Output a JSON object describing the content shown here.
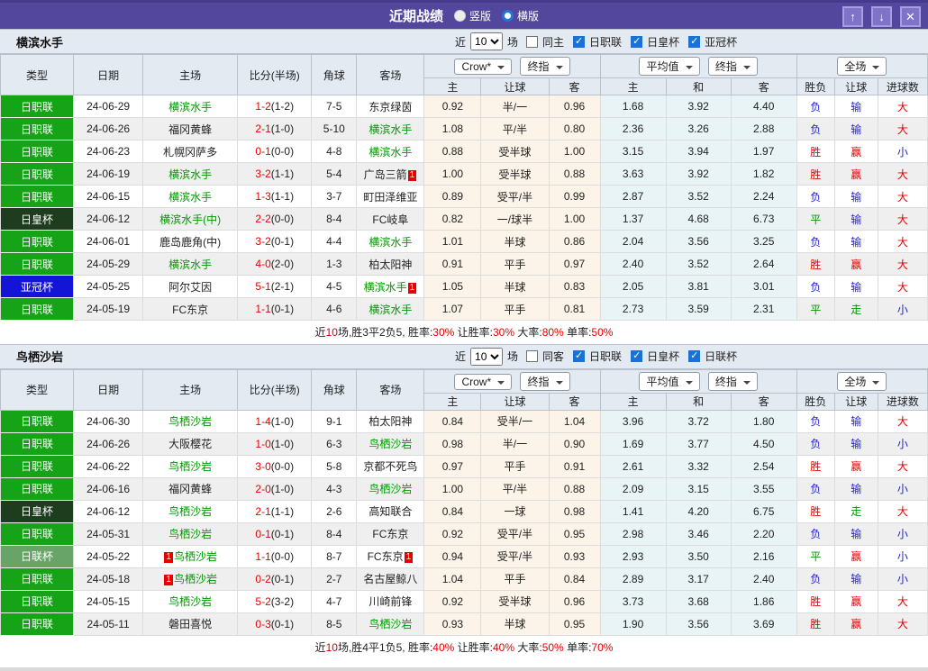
{
  "title_bar": {
    "title": "近期战绩",
    "radio_vertical_label": "竖版",
    "radio_horizontal_label": "横版",
    "up_icon": "↑",
    "down_icon": "↓",
    "close_icon": "✕"
  },
  "columns": {
    "type": "类型",
    "date": "日期",
    "home": "主场",
    "score": "比分(半场)",
    "corner": "角球",
    "away": "客场",
    "odds_source_dd": "Crow*",
    "odds_final_dd": "终指",
    "avg_dd": "平均值",
    "avg_final_dd": "终指",
    "fulltime_dd": "全场",
    "odds_home": "主",
    "odds_handicap": "让球",
    "odds_away": "客",
    "avg_home": "主",
    "avg_draw": "和",
    "avg_away": "客",
    "result_wdl": "胜负",
    "result_handicap": "让球",
    "result_goals": "进球数"
  },
  "league_colors": {
    "日职联": "#17a317",
    "日皇杯": "#1e3c1e",
    "亚冠杯": "#1414d6",
    "日联杯": "#68a468"
  },
  "result_colors": {
    "r": "#e60000",
    "b": "#2323cc",
    "g": "#009900"
  },
  "sections": [
    {
      "team": "横滨水手",
      "filters": {
        "near": "近",
        "count": "10",
        "games": "场",
        "same": "同主",
        "leagues": [
          "日职联",
          "日皇杯",
          "亚冠杯"
        ]
      },
      "rows": [
        {
          "league": "日职联",
          "date": "24-06-29",
          "home": "横滨水手",
          "home_self": true,
          "away": "东京绿茵",
          "away_self": false,
          "score": "1-2",
          "half": "(1-2)",
          "corner": "7-5",
          "odds": [
            "0.92",
            "半/一",
            "0.96"
          ],
          "avg": [
            "1.68",
            "3.92",
            "4.40"
          ],
          "res": [
            [
              "负",
              "b"
            ],
            [
              "输",
              "b"
            ],
            [
              "大",
              "r"
            ]
          ]
        },
        {
          "league": "日职联",
          "date": "24-06-26",
          "home": "福冈黄蜂",
          "home_self": false,
          "away": "横滨水手",
          "away_self": true,
          "score": "2-1",
          "half": "(1-0)",
          "corner": "5-10",
          "odds": [
            "1.08",
            "平/半",
            "0.80"
          ],
          "avg": [
            "2.36",
            "3.26",
            "2.88"
          ],
          "res": [
            [
              "负",
              "b"
            ],
            [
              "输",
              "b"
            ],
            [
              "大",
              "r"
            ]
          ]
        },
        {
          "league": "日职联",
          "date": "24-06-23",
          "home": "札幌冈萨多",
          "home_self": false,
          "away": "横滨水手",
          "away_self": true,
          "score": "0-1",
          "half": "(0-0)",
          "corner": "4-8",
          "odds": [
            "0.88",
            "受半球",
            "1.00"
          ],
          "avg": [
            "3.15",
            "3.94",
            "1.97"
          ],
          "res": [
            [
              "胜",
              "r"
            ],
            [
              "赢",
              "r"
            ],
            [
              "小",
              "b"
            ]
          ]
        },
        {
          "league": "日职联",
          "date": "24-06-19",
          "home": "横滨水手",
          "home_self": true,
          "away": "广岛三箭",
          "away_self": false,
          "away_card_after": "1",
          "score": "3-2",
          "half": "(1-1)",
          "corner": "5-4",
          "odds": [
            "1.00",
            "受半球",
            "0.88"
          ],
          "avg": [
            "3.63",
            "3.92",
            "1.82"
          ],
          "res": [
            [
              "胜",
              "r"
            ],
            [
              "赢",
              "r"
            ],
            [
              "大",
              "r"
            ]
          ]
        },
        {
          "league": "日职联",
          "date": "24-06-15",
          "home": "横滨水手",
          "home_self": true,
          "away": "町田泽维亚",
          "away_self": false,
          "score": "1-3",
          "half": "(1-1)",
          "corner": "3-7",
          "odds": [
            "0.89",
            "受平/半",
            "0.99"
          ],
          "avg": [
            "2.87",
            "3.52",
            "2.24"
          ],
          "res": [
            [
              "负",
              "b"
            ],
            [
              "输",
              "b"
            ],
            [
              "大",
              "r"
            ]
          ]
        },
        {
          "league": "日皇杯",
          "date": "24-06-12",
          "home": "横滨水手(中)",
          "home_self": true,
          "away": "FC岐阜",
          "away_self": false,
          "score": "2-2",
          "half": "(0-0)",
          "corner": "8-4",
          "odds": [
            "0.82",
            "一/球半",
            "1.00"
          ],
          "avg": [
            "1.37",
            "4.68",
            "6.73"
          ],
          "res": [
            [
              "平",
              "g"
            ],
            [
              "输",
              "b"
            ],
            [
              "大",
              "r"
            ]
          ]
        },
        {
          "league": "日职联",
          "date": "24-06-01",
          "home": "鹿岛鹿角(中)",
          "home_self": false,
          "away": "横滨水手",
          "away_self": true,
          "score": "3-2",
          "half": "(0-1)",
          "corner": "4-4",
          "odds": [
            "1.01",
            "半球",
            "0.86"
          ],
          "avg": [
            "2.04",
            "3.56",
            "3.25"
          ],
          "res": [
            [
              "负",
              "b"
            ],
            [
              "输",
              "b"
            ],
            [
              "大",
              "r"
            ]
          ]
        },
        {
          "league": "日职联",
          "date": "24-05-29",
          "home": "横滨水手",
          "home_self": true,
          "away": "柏太阳神",
          "away_self": false,
          "score": "4-0",
          "half": "(2-0)",
          "corner": "1-3",
          "odds": [
            "0.91",
            "平手",
            "0.97"
          ],
          "avg": [
            "2.40",
            "3.52",
            "2.64"
          ],
          "res": [
            [
              "胜",
              "r"
            ],
            [
              "赢",
              "r"
            ],
            [
              "大",
              "r"
            ]
          ]
        },
        {
          "league": "亚冠杯",
          "date": "24-05-25",
          "home": "阿尔艾因",
          "home_self": false,
          "away": "横滨水手",
          "away_self": true,
          "away_card_after": "1",
          "score": "5-1",
          "half": "(2-1)",
          "corner": "4-5",
          "odds": [
            "1.05",
            "半球",
            "0.83"
          ],
          "avg": [
            "2.05",
            "3.81",
            "3.01"
          ],
          "res": [
            [
              "负",
              "b"
            ],
            [
              "输",
              "b"
            ],
            [
              "大",
              "r"
            ]
          ]
        },
        {
          "league": "日职联",
          "date": "24-05-19",
          "home": "FC东京",
          "home_self": false,
          "away": "横滨水手",
          "away_self": true,
          "score": "1-1",
          "half": "(0-1)",
          "corner": "4-6",
          "odds": [
            "1.07",
            "平手",
            "0.81"
          ],
          "avg": [
            "2.73",
            "3.59",
            "2.31"
          ],
          "res": [
            [
              "平",
              "g"
            ],
            [
              "走",
              "g"
            ],
            [
              "小",
              "b"
            ]
          ]
        }
      ],
      "summary": [
        {
          "t": "近",
          "c": "k"
        },
        {
          "t": "10",
          "c": "r"
        },
        {
          "t": "场,胜3平2负5, 胜率:",
          "c": "k"
        },
        {
          "t": "30%",
          "c": "r"
        },
        {
          "t": " 让胜率:",
          "c": "k"
        },
        {
          "t": "30%",
          "c": "r"
        },
        {
          "t": " 大率:",
          "c": "k"
        },
        {
          "t": "80%",
          "c": "r"
        },
        {
          "t": " 单率:",
          "c": "k"
        },
        {
          "t": "50%",
          "c": "r"
        }
      ]
    },
    {
      "team": "鸟栖沙岩",
      "filters": {
        "near": "近",
        "count": "10",
        "games": "场",
        "same": "同客",
        "leagues": [
          "日职联",
          "日皇杯",
          "日联杯"
        ]
      },
      "rows": [
        {
          "league": "日职联",
          "date": "24-06-30",
          "home": "鸟栖沙岩",
          "home_self": true,
          "away": "柏太阳神",
          "away_self": false,
          "score": "1-4",
          "half": "(1-0)",
          "corner": "9-1",
          "odds": [
            "0.84",
            "受半/一",
            "1.04"
          ],
          "avg": [
            "3.96",
            "3.72",
            "1.80"
          ],
          "res": [
            [
              "负",
              "b"
            ],
            [
              "输",
              "b"
            ],
            [
              "大",
              "r"
            ]
          ]
        },
        {
          "league": "日职联",
          "date": "24-06-26",
          "home": "大阪樱花",
          "home_self": false,
          "away": "鸟栖沙岩",
          "away_self": true,
          "score": "1-0",
          "half": "(1-0)",
          "corner": "6-3",
          "odds": [
            "0.98",
            "半/一",
            "0.90"
          ],
          "avg": [
            "1.69",
            "3.77",
            "4.50"
          ],
          "res": [
            [
              "负",
              "b"
            ],
            [
              "输",
              "b"
            ],
            [
              "小",
              "b"
            ]
          ]
        },
        {
          "league": "日职联",
          "date": "24-06-22",
          "home": "鸟栖沙岩",
          "home_self": true,
          "away": "京都不死鸟",
          "away_self": false,
          "score": "3-0",
          "half": "(0-0)",
          "corner": "5-8",
          "odds": [
            "0.97",
            "平手",
            "0.91"
          ],
          "avg": [
            "2.61",
            "3.32",
            "2.54"
          ],
          "res": [
            [
              "胜",
              "r"
            ],
            [
              "赢",
              "r"
            ],
            [
              "大",
              "r"
            ]
          ]
        },
        {
          "league": "日职联",
          "date": "24-06-16",
          "home": "福冈黄蜂",
          "home_self": false,
          "away": "鸟栖沙岩",
          "away_self": true,
          "score": "2-0",
          "half": "(1-0)",
          "corner": "4-3",
          "odds": [
            "1.00",
            "平/半",
            "0.88"
          ],
          "avg": [
            "2.09",
            "3.15",
            "3.55"
          ],
          "res": [
            [
              "负",
              "b"
            ],
            [
              "输",
              "b"
            ],
            [
              "小",
              "b"
            ]
          ]
        },
        {
          "league": "日皇杯",
          "date": "24-06-12",
          "home": "鸟栖沙岩",
          "home_self": true,
          "away": "高知联合",
          "away_self": false,
          "score": "2-1",
          "half": "(1-1)",
          "corner": "2-6",
          "odds": [
            "0.84",
            "一球",
            "0.98"
          ],
          "avg": [
            "1.41",
            "4.20",
            "6.75"
          ],
          "res": [
            [
              "胜",
              "r"
            ],
            [
              "走",
              "g"
            ],
            [
              "大",
              "r"
            ]
          ]
        },
        {
          "league": "日职联",
          "date": "24-05-31",
          "home": "鸟栖沙岩",
          "home_self": true,
          "away": "FC东京",
          "away_self": false,
          "score": "0-1",
          "half": "(0-1)",
          "corner": "8-4",
          "odds": [
            "0.92",
            "受平/半",
            "0.95"
          ],
          "avg": [
            "2.98",
            "3.46",
            "2.20"
          ],
          "res": [
            [
              "负",
              "b"
            ],
            [
              "输",
              "b"
            ],
            [
              "小",
              "b"
            ]
          ]
        },
        {
          "league": "日联杯",
          "date": "24-05-22",
          "home": "鸟栖沙岩",
          "home_self": true,
          "home_card_before": "1",
          "away": "FC东京",
          "away_self": false,
          "away_card_after": "1",
          "score": "1-1",
          "half": "(0-0)",
          "corner": "8-7",
          "odds": [
            "0.94",
            "受平/半",
            "0.93"
          ],
          "avg": [
            "2.93",
            "3.50",
            "2.16"
          ],
          "res": [
            [
              "平",
              "g"
            ],
            [
              "赢",
              "r"
            ],
            [
              "小",
              "b"
            ]
          ]
        },
        {
          "league": "日职联",
          "date": "24-05-18",
          "home": "鸟栖沙岩",
          "home_self": true,
          "home_card_before": "1",
          "away": "名古屋鲸八",
          "away_self": false,
          "score": "0-2",
          "half": "(0-1)",
          "corner": "2-7",
          "odds": [
            "1.04",
            "平手",
            "0.84"
          ],
          "avg": [
            "2.89",
            "3.17",
            "2.40"
          ],
          "res": [
            [
              "负",
              "b"
            ],
            [
              "输",
              "b"
            ],
            [
              "小",
              "b"
            ]
          ]
        },
        {
          "league": "日职联",
          "date": "24-05-15",
          "home": "鸟栖沙岩",
          "home_self": true,
          "away": "川崎前锋",
          "away_self": false,
          "score": "5-2",
          "half": "(3-2)",
          "corner": "4-7",
          "odds": [
            "0.92",
            "受半球",
            "0.96"
          ],
          "avg": [
            "3.73",
            "3.68",
            "1.86"
          ],
          "res": [
            [
              "胜",
              "r"
            ],
            [
              "赢",
              "r"
            ],
            [
              "大",
              "r"
            ]
          ]
        },
        {
          "league": "日职联",
          "date": "24-05-11",
          "home": "磐田喜悦",
          "home_self": false,
          "away": "鸟栖沙岩",
          "away_self": true,
          "score": "0-3",
          "half": "(0-1)",
          "corner": "8-5",
          "odds": [
            "0.93",
            "半球",
            "0.95"
          ],
          "avg": [
            "1.90",
            "3.56",
            "3.69"
          ],
          "res": [
            [
              "胜",
              "r"
            ],
            [
              "赢",
              "r"
            ],
            [
              "大",
              "r"
            ]
          ]
        }
      ],
      "summary": [
        {
          "t": "近",
          "c": "k"
        },
        {
          "t": "10",
          "c": "r"
        },
        {
          "t": "场,胜4平1负5, 胜率:",
          "c": "k"
        },
        {
          "t": "40%",
          "c": "r"
        },
        {
          "t": " 让胜率:",
          "c": "k"
        },
        {
          "t": "40%",
          "c": "r"
        },
        {
          "t": " 大率:",
          "c": "k"
        },
        {
          "t": "50%",
          "c": "r"
        },
        {
          "t": " 单率:",
          "c": "k"
        },
        {
          "t": "70%",
          "c": "r"
        }
      ]
    }
  ]
}
